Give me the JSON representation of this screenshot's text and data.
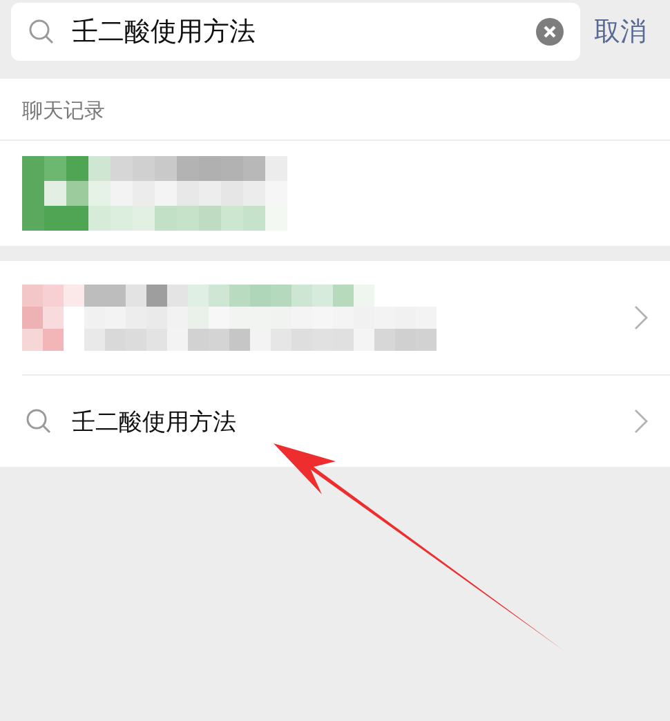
{
  "search": {
    "value": "壬二酸使用方法",
    "cancel": "取消"
  },
  "chat_history": {
    "title": "聊天记录"
  },
  "suggestion": {
    "text": "壬二酸使用方法"
  }
}
